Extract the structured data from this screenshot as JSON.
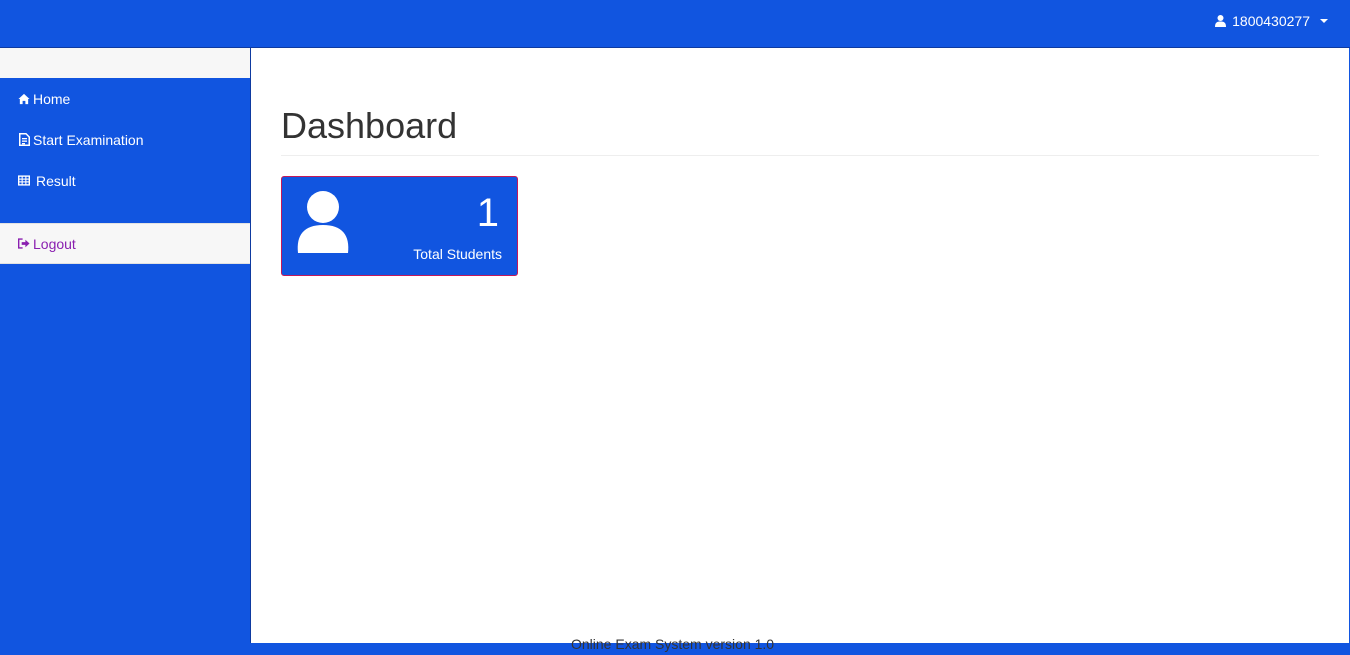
{
  "header": {
    "username": "1800430277",
    "user_icon": "user-icon",
    "caret_icon": "caret-down-icon"
  },
  "sidebar": {
    "items": [
      {
        "label": "Home",
        "icon": "home-icon"
      },
      {
        "label": "Start Examination",
        "icon": "document-icon"
      },
      {
        "label": "Result",
        "icon": "table-icon"
      },
      {
        "label": "Logout",
        "icon": "logout-icon"
      }
    ]
  },
  "main": {
    "title": "Dashboard",
    "cards": [
      {
        "value": "1",
        "label": "Total Students",
        "icon": "user-icon"
      }
    ]
  },
  "footer": {
    "text": "Online Exam System version 1.0"
  },
  "colors": {
    "primary": "#1155e0",
    "card_border": "#c2185b",
    "logout_text": "#8a1fb0"
  }
}
